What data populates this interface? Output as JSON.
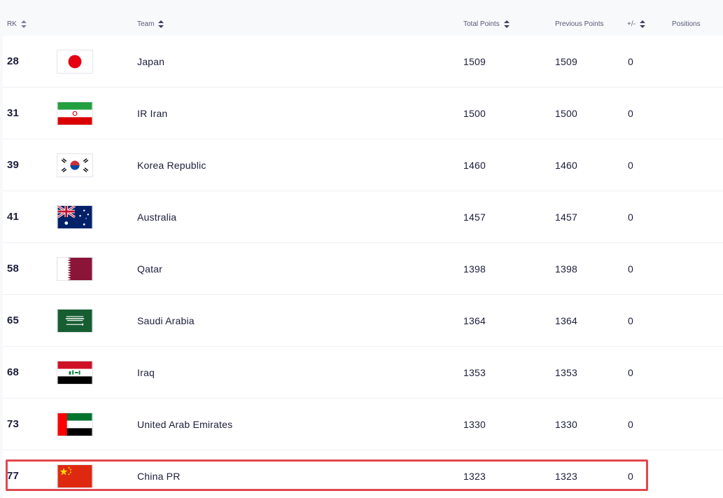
{
  "header": {
    "rk": "RK",
    "team": "Team",
    "total_points": "Total Points",
    "previous_points": "Previous Points",
    "diff": "+/-",
    "positions": "Positions"
  },
  "rows": [
    {
      "rank": "28",
      "team": "Japan",
      "flag": "japan-flag-icon",
      "total": "1509",
      "previous": "1509",
      "diff": "0"
    },
    {
      "rank": "31",
      "team": "IR Iran",
      "flag": "iran-flag-icon",
      "total": "1500",
      "previous": "1500",
      "diff": "0"
    },
    {
      "rank": "39",
      "team": "Korea Republic",
      "flag": "korea-flag-icon",
      "total": "1460",
      "previous": "1460",
      "diff": "0"
    },
    {
      "rank": "41",
      "team": "Australia",
      "flag": "australia-flag-icon",
      "total": "1457",
      "previous": "1457",
      "diff": "0"
    },
    {
      "rank": "58",
      "team": "Qatar",
      "flag": "qatar-flag-icon",
      "total": "1398",
      "previous": "1398",
      "diff": "0"
    },
    {
      "rank": "65",
      "team": "Saudi Arabia",
      "flag": "saudi-arabia-flag-icon",
      "total": "1364",
      "previous": "1364",
      "diff": "0"
    },
    {
      "rank": "68",
      "team": "Iraq",
      "flag": "iraq-flag-icon",
      "total": "1353",
      "previous": "1353",
      "diff": "0"
    },
    {
      "rank": "73",
      "team": "United Arab Emirates",
      "flag": "uae-flag-icon",
      "total": "1330",
      "previous": "1330",
      "diff": "0"
    },
    {
      "rank": "77",
      "team": "China PR",
      "flag": "china-flag-icon",
      "total": "1323",
      "previous": "1323",
      "diff": "0"
    }
  ],
  "colors": {
    "highlight": "#e0474f",
    "text": "#1b1d3a",
    "header_text": "#555a73"
  },
  "highlighted_team": "China PR"
}
